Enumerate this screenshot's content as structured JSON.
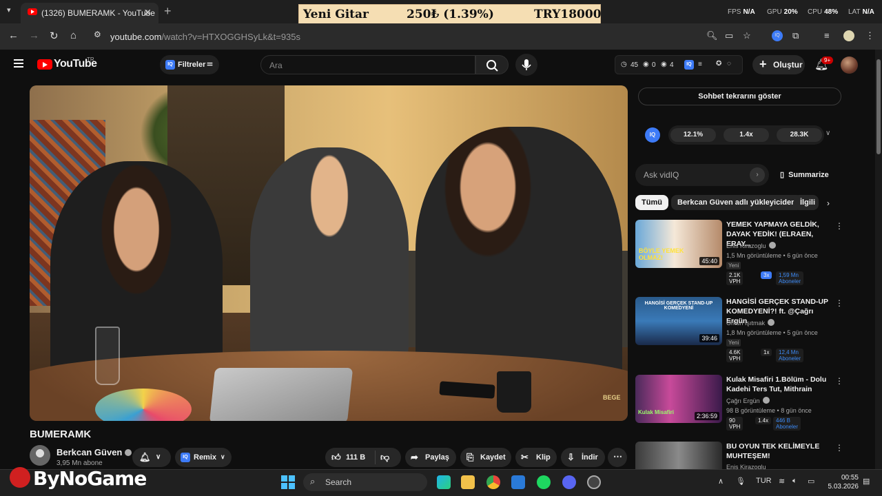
{
  "browser": {
    "tab_title": "(1326) BUMERAMK - YouTube",
    "url_host": "youtube.com",
    "url_rest": "/watch?v=HTXOGGHSyLk&t=935s"
  },
  "ticker": {
    "name": "Yeni Gitar",
    "change": "250₺ (1.39%)",
    "price": "TRY18000"
  },
  "perf": {
    "fps_label": "FPS",
    "fps": "N/A",
    "gpu_label": "GPU",
    "gpu": "20%",
    "cpu_label": "CPU",
    "cpu": "48%",
    "lat_label": "LAT",
    "lat": "N/A"
  },
  "yt": {
    "logo": "YouTube",
    "country": "TR",
    "filters": "Filtreler",
    "search_placeholder": "Ara",
    "stats": {
      "a": "45",
      "b": "0",
      "c": "4"
    },
    "create": "Oluştur",
    "notif_badge": "9+"
  },
  "video": {
    "title": "BUMERAMK",
    "watermark": "BEGE",
    "channel": "Berkcan Güven",
    "subscribers": "3,95 Mn abone",
    "remix": "Remix",
    "likes": "111 B",
    "share": "Paylaş",
    "save": "Kaydet",
    "clip": "Klip",
    "download": "İndir"
  },
  "sidebar": {
    "chat_replay": "Sohbet tekrarını göster",
    "vidiq_metrics": [
      "12.1%",
      "1.4x",
      "28.3K"
    ],
    "ask_placeholder": "Ask vidIQ",
    "summarize": "Summarize",
    "chips": [
      "Tümü",
      "Berkcan Güven adlı yükleyiciden",
      "İlgili"
    ],
    "recs": [
      {
        "title": "YEMEK YAPMAYA GELDİK, DAYAK YEDİK! (ELRAEN, ERAY...",
        "channel": "Enis Kirazoglu",
        "meta": "1,5 Mn görüntüleme • 6 gün önce",
        "badge": "Yeni",
        "duration": "45:40",
        "vph": "2.1K VPH",
        "mult": "3x",
        "subs": "1,59 Mn Aboneler",
        "thumb_text": "BÖYLE YEMEK OLMAZ!"
      },
      {
        "title": "HANGİSİ GERÇEK STAND-UP KOMEDYENİ?! ft. @Çağrı Ergün",
        "channel": "Orkun Işıtmak",
        "meta": "1,8 Mn görüntüleme • 5 gün önce",
        "badge": "Yeni",
        "duration": "39:46",
        "vph": "4.6K VPH",
        "mult": "1x",
        "subs": "12,4 Mn Aboneler",
        "thumb_text": "HANGİSİ GERÇEK STAND-UP KOMEDYENİ"
      },
      {
        "title": "Kulak Misafiri 1.Bölüm - Dolu Kadehi Ters Tut, Mithrain",
        "channel": "Çağrı Ergün",
        "meta": "98 B görüntüleme • 8 gün önce",
        "badge": "",
        "duration": "2:36:59",
        "vph": "90 VPH",
        "mult": "1.4x",
        "subs": "446 B Aboneler",
        "thumb_text": "Kulak Misafiri"
      },
      {
        "title": "BU OYUN TEK KELİMEYLE MUHTEŞEM!",
        "channel": "Enis Kirazoglu",
        "meta": "",
        "badge": "",
        "duration": "",
        "vph": "",
        "mult": "",
        "subs": "",
        "thumb_text": ""
      }
    ]
  },
  "taskbar": {
    "brand": "ByNoGame",
    "search": "Search",
    "lang": "TUR",
    "time": "00:55",
    "date": "5.03.2026"
  }
}
